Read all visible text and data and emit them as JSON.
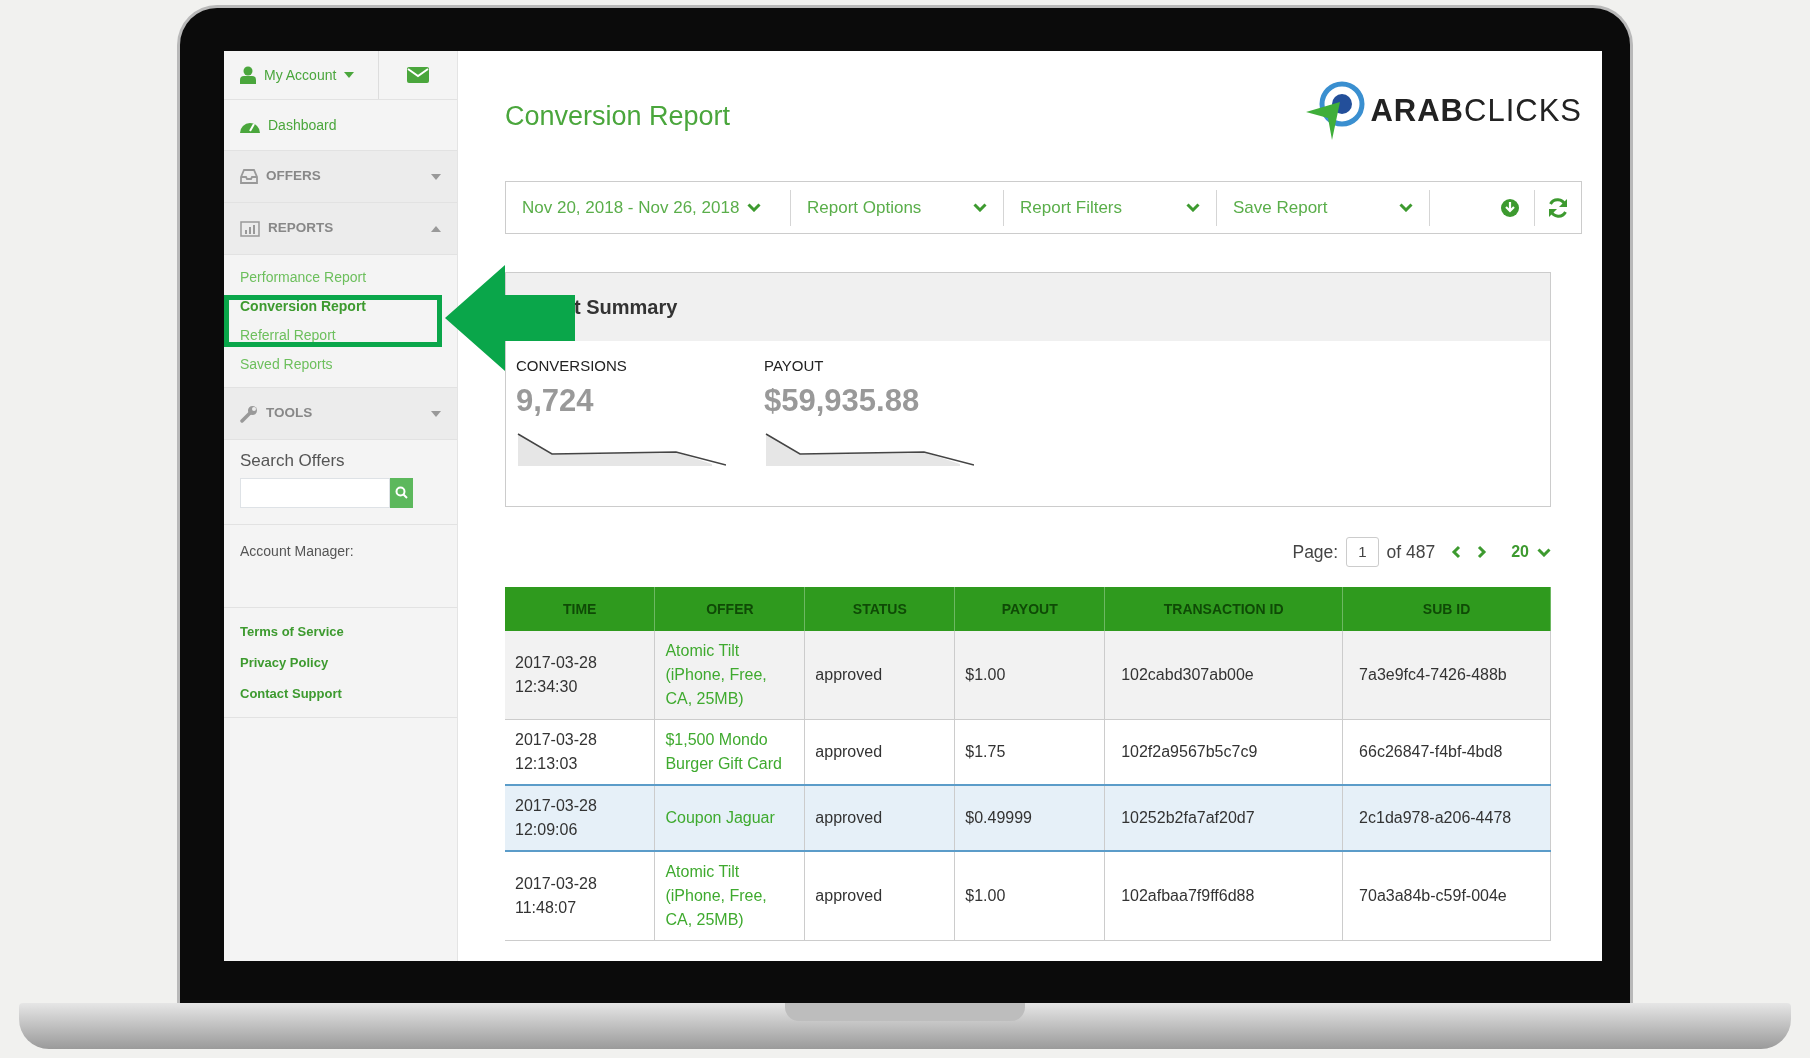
{
  "sidebar": {
    "account": {
      "label": "My Account"
    },
    "items": [
      {
        "kind": "link",
        "label": "Dashboard"
      },
      {
        "kind": "section",
        "label": "OFFERS",
        "expanded": false
      },
      {
        "kind": "section",
        "label": "REPORTS",
        "expanded": true,
        "children": [
          {
            "label": "Performance Report",
            "selected": false
          },
          {
            "label": "Conversion Report",
            "selected": true
          },
          {
            "label": "Referral Report",
            "selected": false
          },
          {
            "label": "Saved Reports",
            "selected": false
          }
        ]
      },
      {
        "kind": "section",
        "label": "TOOLS",
        "expanded": false
      }
    ],
    "search": {
      "label": "Search Offers"
    },
    "account_manager": "Account Manager:",
    "footer_links": [
      "Terms of Service",
      "Privacy Policy",
      "Contact Support"
    ]
  },
  "page_title": "Conversion Report",
  "logo": "**ARAB**CLICKS",
  "toolbar": {
    "date_range": "Nov 20, 2018 - Nov 26, 2018",
    "menus": [
      "Report Options",
      "Report Filters",
      "Save Report"
    ]
  },
  "summary": {
    "title": "t Summary",
    "metrics": [
      {
        "label": "CONVERSIONS",
        "value": "9,724"
      },
      {
        "label": "PAYOUT",
        "value": "$59,935.88"
      }
    ]
  },
  "pagination": {
    "label": "Page:",
    "page": "1",
    "total": "of 487",
    "per_page": "20"
  },
  "table": {
    "columns": [
      "TIME",
      "OFFER",
      "STATUS",
      "PAYOUT",
      "TRANSACTION ID",
      "SUB ID"
    ],
    "rows": [
      {
        "time": "2017-03-28 12:34:30",
        "offer": "Atomic Tilt (iPhone, Free, CA, 25MB)",
        "status": "approved",
        "payout": "$1.00",
        "transaction_id": "102cabd307ab00e",
        "sub_id": "7a3e9fc4-7426-488b",
        "selected": false
      },
      {
        "time": "2017-03-28 12:13:03",
        "offer": "$1,500 Mondo Burger Gift Card",
        "status": "approved",
        "payout": "$1.75",
        "transaction_id": "102f2a9567b5c7c9",
        "sub_id": "66c26847-f4bf-4bd8",
        "selected": false
      },
      {
        "time": "2017-03-28 12:09:06",
        "offer": "Coupon Jaguar",
        "status": "approved",
        "payout": "$0.49999",
        "transaction_id": "10252b2fa7af20d7",
        "sub_id": "2c1da978-a206-4478",
        "selected": true
      },
      {
        "time": "2017-03-28 11:48:07",
        "offer": "Atomic Tilt (iPhone, Free, CA, 25MB)",
        "status": "approved",
        "payout": "$1.00",
        "transaction_id": "102afbaa7f9ff6d88",
        "sub_id": "70a3a84b-c59f-004e",
        "selected": false
      }
    ]
  }
}
